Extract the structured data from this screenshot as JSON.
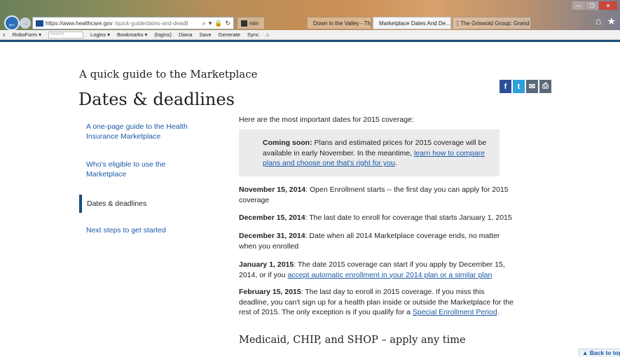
{
  "browser": {
    "url_domain": "https://www.healthcare.gov",
    "url_path": "/quick-guide/dates-and-deadli",
    "min_label": "min",
    "tabs": [
      {
        "label": "Down in the Valley - The He..."
      },
      {
        "label": "Marketplace Dates And De...",
        "active": true
      },
      {
        "label": "The Griswold Group: Grand Ra..."
      }
    ],
    "favorites": {
      "close": "x",
      "roboform": "RoboForm ▾",
      "search": "Search",
      "logins": "Logins ▾",
      "bookmarks": "Bookmarks ▾",
      "logins_alt": "(logins)",
      "diana": "Diana",
      "save": "Save",
      "generate": "Generate",
      "sync": "Sync"
    }
  },
  "page": {
    "kicker": "A quick guide to the Marketplace",
    "title": "Dates & deadlines",
    "sidenav": [
      {
        "label": "A one-page guide to the Health Insurance Marketplace"
      },
      {
        "label": "Who's eligible to use the Marketplace"
      },
      {
        "label": "Dates & deadlines",
        "active": true
      },
      {
        "label": "Next steps to get started"
      }
    ],
    "social": {
      "fb": "f",
      "tw": "t",
      "em": "✉",
      "pr": "⎙"
    },
    "intro": "Here are the most important dates for 2015 coverage:",
    "callout": {
      "bold": "Coming soon:",
      "text": " Plans and estimated prices for 2015 coverage will be available in early November. In the meantime, ",
      "link": "learn how to compare plans and choose one that's right for you",
      "end": "."
    },
    "dates": [
      {
        "date": "November 15, 2014",
        "text": ": Open Enrollment starts -- the first day you can apply for 2015 coverage"
      },
      {
        "date": "December 15, 2014",
        "text": ": The last date to enroll for coverage that starts January 1, 2015"
      },
      {
        "date": "December 31, 2014",
        "text": ": Date when all 2014 Marketplace coverage ends, no matter when you enrolled"
      },
      {
        "date": "January 1, 2015",
        "text": ": The date 2015 coverage can start if you apply by December 15, 2014, or if you ",
        "link": "accept automatic enrollment in your 2014 plan or a similar plan"
      },
      {
        "date": "February 15, 2015",
        "text": ": The last day to enroll in 2015 coverage. If you miss this deadline, you can't sign up for a health plan inside or outside the Marketplace for the rest of 2015. The only exception is if you qualify for a ",
        "link": "Special Enrollment Period",
        "end": "."
      }
    ],
    "section_heading": "Medicaid, CHIP, and SHOP – apply any time",
    "back_to_top": "▲ Back to top"
  }
}
